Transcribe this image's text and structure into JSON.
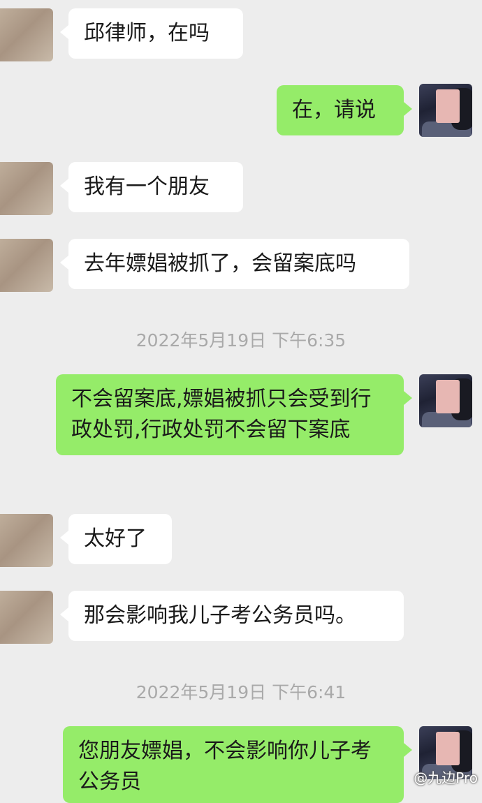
{
  "messages": [
    {
      "side": "in",
      "text": "邱律师，在吗"
    },
    {
      "side": "out",
      "text": "在，请说"
    },
    {
      "side": "in",
      "text": "我有一个朋友"
    },
    {
      "side": "in",
      "text": "去年嫖娼被抓了，会留案底吗"
    },
    {
      "side": "out",
      "text": "不会留案底,嫖娼被抓只会受到行政处罚,行政处罚不会留下案底"
    },
    {
      "side": "in",
      "text": "太好了"
    },
    {
      "side": "in",
      "text": "那会影响我儿子考公务员吗。"
    },
    {
      "side": "out",
      "text": "您朋友嫖娼，不会影响你儿子考公务员"
    }
  ],
  "timestamps": [
    "2022年5月19日 下午6:35",
    "2022年5月19日 下午6:41"
  ],
  "watermark": "@九边Pro",
  "colors": {
    "background": "#ededed",
    "incoming_bubble": "#ffffff",
    "outgoing_bubble": "#95ec69",
    "timestamp": "#a9a9a9"
  }
}
